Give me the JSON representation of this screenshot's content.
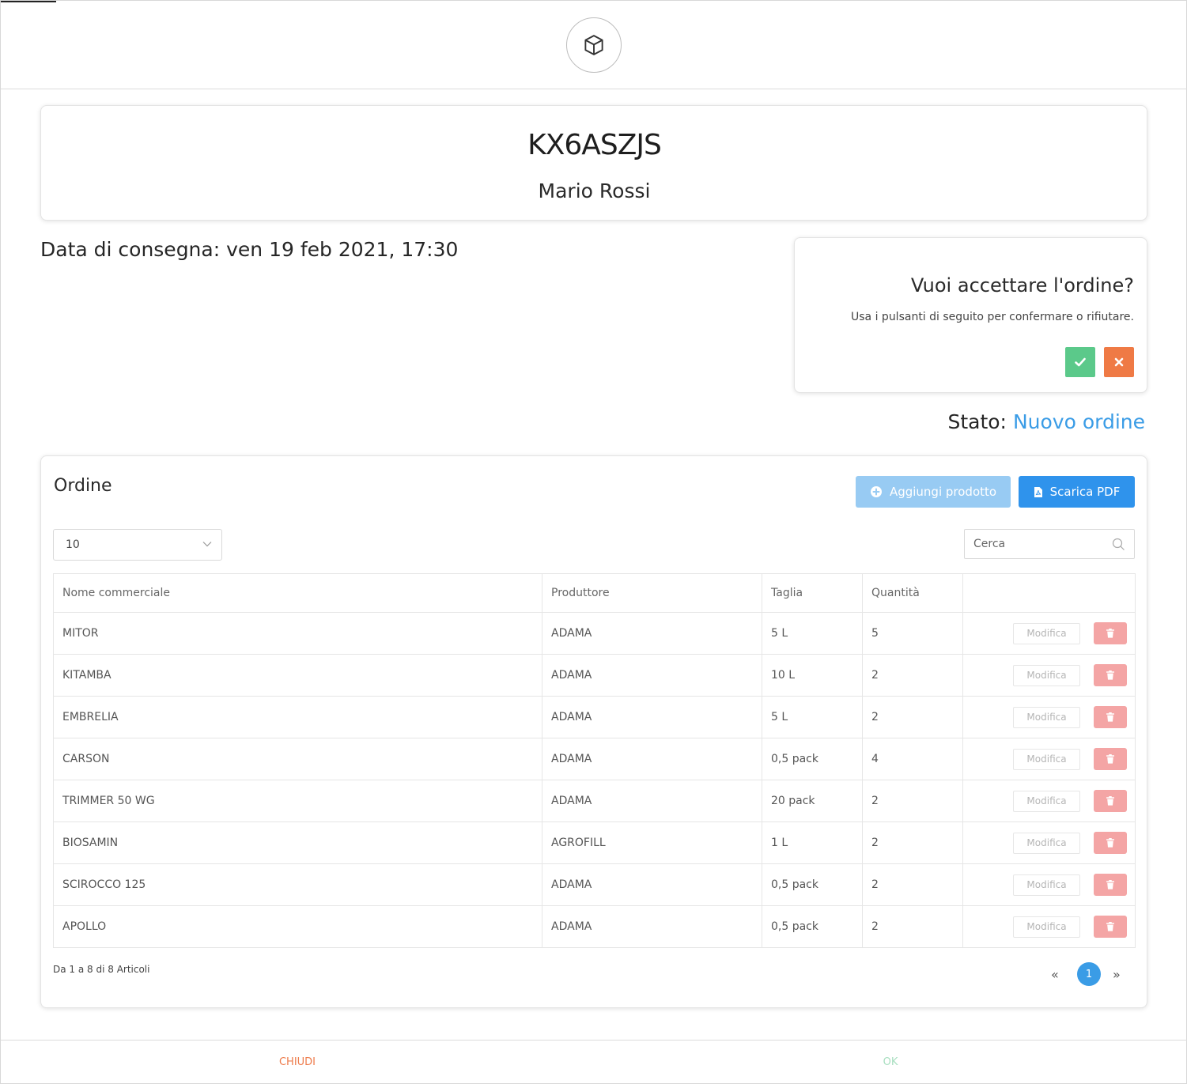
{
  "header": {
    "icon": "box-icon"
  },
  "order": {
    "code": "KX6ASZJS",
    "customer": "Mario Rossi"
  },
  "delivery": {
    "label": "Data di consegna: ven 19 feb 2021, 17:30"
  },
  "accept": {
    "title": "Vuoi accettare l'ordine?",
    "subtitle": "Usa i pulsanti di seguito per confermare o rifiutare.",
    "confirm_icon": "check-icon",
    "reject_icon": "close-icon"
  },
  "status": {
    "label": "Stato:",
    "value": "Nuovo ordine"
  },
  "order_card": {
    "title": "Ordine",
    "add_product_label": "Aggiungi prodotto",
    "download_pdf_label": "Scarica PDF"
  },
  "controls": {
    "page_size": "10",
    "search_placeholder": "Cerca"
  },
  "table": {
    "headers": [
      "Nome commerciale",
      "Produttore",
      "Taglia",
      "Quantità",
      ""
    ],
    "edit_label": "Modifica",
    "rows": [
      {
        "name": "MITOR",
        "producer": "ADAMA",
        "size": "5 L",
        "qty": "5"
      },
      {
        "name": "KITAMBA",
        "producer": "ADAMA",
        "size": "10 L",
        "qty": "2"
      },
      {
        "name": "EMBRELIA",
        "producer": "ADAMA",
        "size": "5 L",
        "qty": "2"
      },
      {
        "name": "CARSON",
        "producer": "ADAMA",
        "size": "0,5 pack",
        "qty": "4"
      },
      {
        "name": "TRIMMER 50 WG",
        "producer": "ADAMA",
        "size": "20 pack",
        "qty": "2"
      },
      {
        "name": "BIOSAMIN",
        "producer": "AGROFILL",
        "size": "1 L",
        "qty": "2"
      },
      {
        "name": "SCIROCCO 125",
        "producer": "ADAMA",
        "size": "0,5 pack",
        "qty": "2"
      },
      {
        "name": "APOLLO",
        "producer": "ADAMA",
        "size": "0,5 pack",
        "qty": "2"
      }
    ]
  },
  "pagination": {
    "info": "Da 1 a 8 di 8 Articoli",
    "prev": "«",
    "current": "1",
    "next": "»"
  },
  "footer": {
    "close_label": "CHIUDI",
    "ok_label": "OK"
  },
  "colors": {
    "accent": "#3a9ce6",
    "confirm": "#5bc98a",
    "reject": "#ef7a45",
    "delete": "#f4a5a5"
  }
}
